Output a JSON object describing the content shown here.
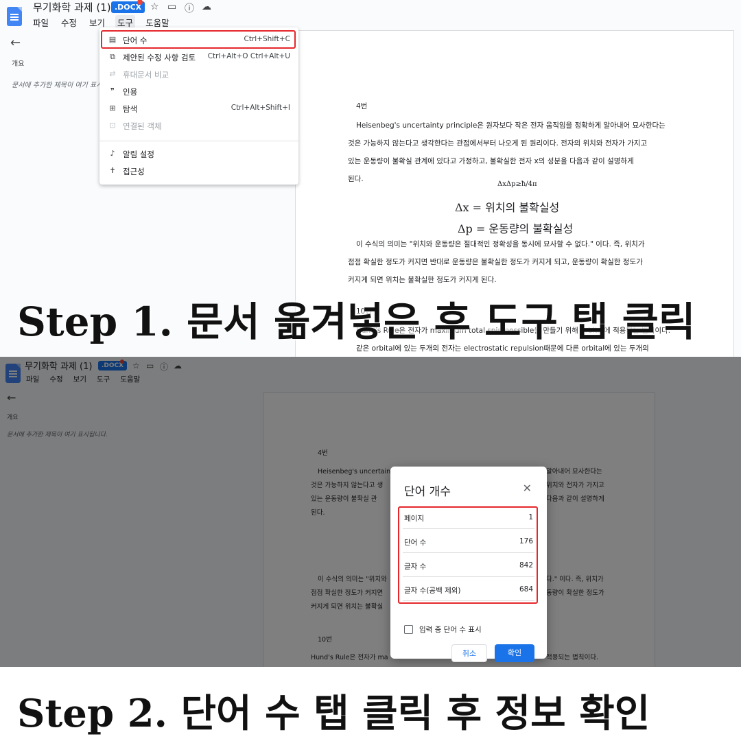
{
  "step1": {
    "app": {
      "title": "무기화학 과제 (1)",
      "badge": ".DOCX",
      "menu": [
        "파일",
        "수정",
        "보기",
        "도구",
        "도움말"
      ]
    },
    "outline": {
      "label": "개요",
      "hint": "문서에 추가한 제목이 여기 표시됩니다."
    },
    "tools_menu": {
      "items": [
        {
          "icon": "word-count-icon",
          "glyph": "▤",
          "label": "단어 수",
          "shortcut": "Ctrl+Shift+C",
          "enabled": true
        },
        {
          "icon": "review-edits-icon",
          "glyph": "⧉",
          "label": "제안된 수정 사항 검토",
          "shortcut": "Ctrl+Alt+O Ctrl+Alt+U",
          "enabled": true
        },
        {
          "icon": "compare-docs-icon",
          "glyph": "⇄",
          "label": "휴대문서 비교",
          "shortcut": "",
          "enabled": false
        },
        {
          "icon": "citation-icon",
          "glyph": "❞",
          "label": "인용",
          "shortcut": "",
          "enabled": true
        },
        {
          "icon": "explore-icon",
          "glyph": "⊞",
          "label": "탐색",
          "shortcut": "Ctrl+Alt+Shift+I",
          "enabled": true
        },
        {
          "icon": "linked-objects-icon",
          "glyph": "⊡",
          "label": "연결된 객체",
          "shortcut": "",
          "enabled": false
        },
        {
          "icon": "notification-bell-icon",
          "glyph": "🔔",
          "label": "알림 설정",
          "shortcut": "",
          "enabled": true
        },
        {
          "icon": "accessibility-icon",
          "glyph": "✝",
          "label": "접근성",
          "shortcut": "",
          "enabled": true
        }
      ]
    },
    "doc": {
      "heading": "4번",
      "para1": [
        "Heisenbeg's uncertainty principle은 원자보다 작은 전자 움직임을 정확하게 알아내어 묘사한다는",
        "것은 가능하지 않는다고 생각한다는 관점에서부터 나오게 된 원리이다. 전자의 위치와 전자가 가지고",
        "있는 운동량이 불확실 관계에 있다고 가정하고, 불확실한 전자 x의 성분을 다음과 같이 설명하게",
        "된다."
      ],
      "eq0": "ΔxΔp≥ħ/4π",
      "eq1": "Δx = 위치의 불확실성",
      "eq2": "Δp = 운동량의 불확실성",
      "para2": [
        "이 수식의 의미는 \"위치와 운동량은 절대적인 정확성을 동시에 묘사할 수 없다.\" 이다. 즉, 위치가",
        "점점 확실한 정도가 커지면 반대로 운동량은 불확실한 정도가 커지게 되고, 운동량이 확실한 정도가",
        "커지게 되면 위치는 불확실한 정도가 커지게 된다."
      ],
      "heading2": "10번",
      "para3": [
        "Hund's Rule은 전자가 maximum total spin possible을 만들기 위해 orbital에 적용되는 법칙이다.",
        "같은 orbital에 있는 두개의 전자는 electrostatic repulsion때문에 다른 orbital에 있는 두개의"
      ]
    },
    "caption": "Step 1. 문서 옮겨넣은 후 도구 탭 클릭"
  },
  "step2": {
    "app": {
      "title": "무기화학 과제 (1)",
      "badge": ".DOCX",
      "menu": [
        "파일",
        "수정",
        "보기",
        "도구",
        "도움말"
      ]
    },
    "outline": {
      "label": "개요",
      "hint": "문서에 추가한 제목이 여기 표시됩니다."
    },
    "doc": {
      "heading": "4번",
      "para1": [
        "Heisenbeg's uncertainty",
        "것은 가능하지 않는다고 생",
        "있는 운동량이 불확실 관",
        "된다."
      ],
      "para1_right": [
        "알아내어 묘사한다는",
        "위치와 전자가 가지고",
        "다음과 같이 설명하게"
      ],
      "para2": [
        "이 수식의 의미는 \"위치와",
        "점점 확실한 정도가 커지면",
        "커지게 되면 위치는 불확실"
      ],
      "para2_right": [
        "다.\" 이다. 즉, 위치가",
        "동량이 확실한 정도가"
      ],
      "heading2": "10번",
      "para3_left": "Hund's Rule은 전자가 ma",
      "para3_right": "적용되는 법칙이다."
    },
    "dialog": {
      "title": "단어 개수",
      "stats": [
        {
          "label": "페이지",
          "value": "1"
        },
        {
          "label": "단어 수",
          "value": "176"
        },
        {
          "label": "글자 수",
          "value": "842"
        },
        {
          "label": "글자 수(공백 제외)",
          "value": "684"
        }
      ],
      "checkbox_label": "입력 중 단어 수 표시",
      "cancel": "취소",
      "ok": "확인"
    },
    "caption": "Step 2. 단어 수 탭 클릭 후 정보 확인"
  },
  "colors": {
    "accent": "#1a73e8",
    "highlight": "#e5262b",
    "badge_dot": "#ea4335"
  }
}
